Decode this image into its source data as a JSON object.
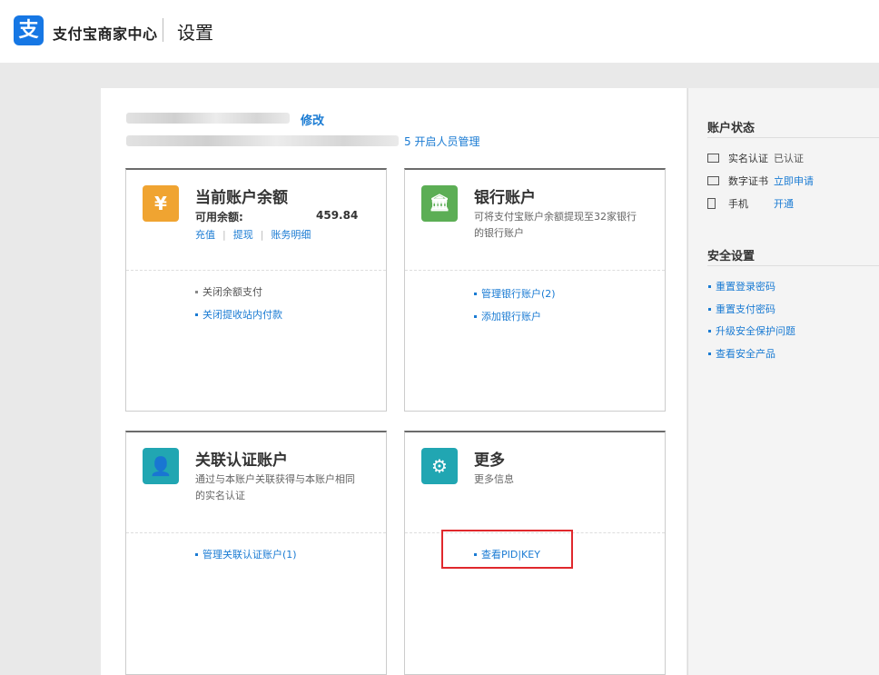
{
  "header": {
    "logo_glyph": "支",
    "brand": "支付宝商家中心",
    "page_title": "设置"
  },
  "account": {
    "edit_label": "修改",
    "open_staff_label": "5 开启人员管理"
  },
  "cards": {
    "balance": {
      "icon": "money-bag-icon",
      "icon_glyph": "¥",
      "title": "当前账户余额",
      "available_label": "可用余额:",
      "available_value": "459.84",
      "actions": [
        "充值",
        "提现",
        "账务明细"
      ],
      "links": [
        "关闭余额支付",
        "关闭提收站内付款"
      ]
    },
    "bank": {
      "icon": "bank-icon",
      "icon_glyph": "🏛",
      "title": "银行账户",
      "desc": "可将支付宝账户余额提现至32家银行的银行账户",
      "links": [
        "管理银行账户(2)",
        "添加银行账户"
      ]
    },
    "linked": {
      "icon": "user-icon",
      "icon_glyph": "👤",
      "title": "关联认证账户",
      "desc": "通过与本账户关联获得与本账户相同的实名认证",
      "links": [
        "管理关联认证账户(1)"
      ]
    },
    "more": {
      "icon": "settings-doc-icon",
      "icon_glyph": "⚙",
      "title": "更多",
      "desc": "更多信息",
      "links": [
        "查看PID|KEY"
      ]
    }
  },
  "side": {
    "status_title": "账户状态",
    "status": [
      {
        "icon": "id-card-icon",
        "label": "实名认证",
        "value": "已认证",
        "value_is_link": false
      },
      {
        "icon": "certificate-icon",
        "label": "数字证书",
        "value": "立即申请",
        "value_is_link": true
      },
      {
        "icon": "phone-icon",
        "label": "手机",
        "value": "开通",
        "value_is_link": true
      }
    ],
    "security_title": "安全设置",
    "security_links": [
      "重置登录密码",
      "重置支付密码",
      "升级安全保护问题",
      "查看安全产品"
    ]
  },
  "colors": {
    "brand_blue": "#1677e4",
    "link_blue": "#1a7bd3",
    "balance_icon": "#f0a431",
    "bank_icon": "#5cae55",
    "linked_icon": "#21a6b2",
    "more_icon": "#21a6b2",
    "highlight_red": "#e0282d"
  }
}
